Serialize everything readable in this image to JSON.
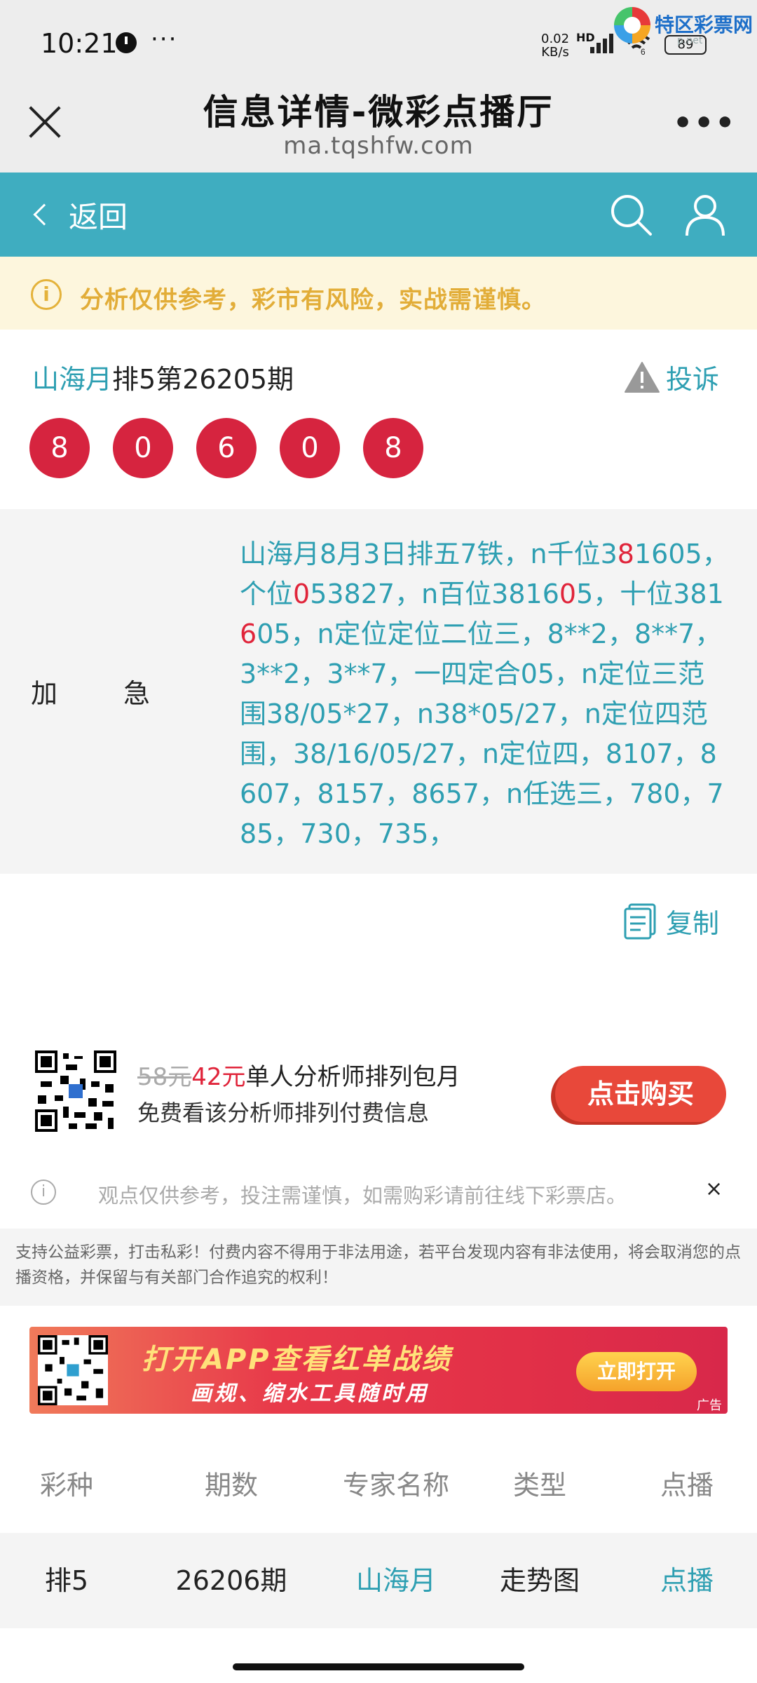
{
  "status_bar": {
    "time": "10:21",
    "more": "···",
    "net_speed_value": "0.02",
    "net_speed_unit": "KB/s",
    "hd": "HD",
    "wifi_badge": "6",
    "battery": "89"
  },
  "watermark": {
    "text": "特区彩票网",
    "sub": "p.net"
  },
  "title_bar": {
    "title": "信息详情-微彩点播厅",
    "url": "ma.tqshfw.com",
    "menu": "•••"
  },
  "nav_bar": {
    "back_label": "返回",
    "accent_color": "#3fadc0"
  },
  "notice": {
    "icon": "i",
    "text": "分析仅供参考，彩市有风险，实战需谨慎。"
  },
  "issue": {
    "expert_name": "山海月",
    "issue_text": "排5第26205期",
    "complain_label": "投诉",
    "balls": [
      "8",
      "0",
      "6",
      "0",
      "8"
    ],
    "ball_color": "#d6243f"
  },
  "content": {
    "label_1": "加",
    "label_2": "急",
    "body_parts": [
      {
        "text": "山海月8月3日排五7铁，n千位3",
        "red": false
      },
      {
        "text": "8",
        "red": true
      },
      {
        "text": "1605，个位",
        "red": false
      },
      {
        "text": "0",
        "red": true
      },
      {
        "text": "53827，n百位3816",
        "red": false
      },
      {
        "text": "0",
        "red": true
      },
      {
        "text": "5，十位381",
        "red": false
      },
      {
        "text": "6",
        "red": true
      },
      {
        "text": "05，n定位定位二位三，8**2，8**7，3**2，3**7，一四定合05，n定位三范围38/05*27，n38*05/27，n定位四范围，38/16/05/27，n定位四，8107，8607，8157，8657，n任选三，780，785，730，735，",
        "red": false
      }
    ]
  },
  "copy": {
    "label": "复制"
  },
  "promo": {
    "old_price": "58元",
    "new_price": "42元",
    "title_rest": "单人分析师排列包月",
    "subtitle": "免费看该分析师排列付费信息",
    "buy_label": "点击购买"
  },
  "disclaimer": {
    "icon": "i",
    "text": "观点仅供参考，投注需谨慎，如需购彩请前往线下彩票店。",
    "close": "×"
  },
  "legal": {
    "text": "支持公益彩票，打击私彩！付费内容不得用于非法用途，若平台发现内容有非法使用，将会取消您的点播资格，并保留与有关部门合作追究的权利！"
  },
  "banner": {
    "title": "打开APP查看红单战绩",
    "subtitle": "画规、缩水工具随时用",
    "open_label": "立即打开",
    "ad_label": "广告"
  },
  "table": {
    "headers": [
      "彩种",
      "期数",
      "专家名称",
      "类型",
      "点播"
    ],
    "rows": [
      [
        "排5",
        "26206期",
        "山海月",
        "走势图",
        "点播"
      ]
    ]
  }
}
